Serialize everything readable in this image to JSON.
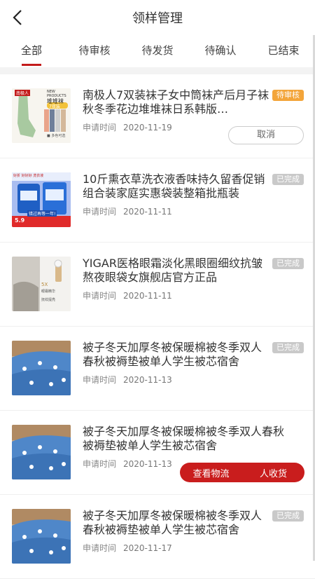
{
  "header": {
    "title": "领样管理"
  },
  "tabs": [
    {
      "label": "全部",
      "active": true
    },
    {
      "label": "待审核"
    },
    {
      "label": "待发货"
    },
    {
      "label": "待确认"
    },
    {
      "label": "已结束"
    }
  ],
  "date_label": "申请时间",
  "items": [
    {
      "name": "南极人7双装袜子女中筒袜产后月子袜秋冬季花边堆堆袜日系韩版…",
      "status": "待审核",
      "status_type": "pending",
      "date": "2020-11-19",
      "action": "取消",
      "thumb": {
        "badge": "南极人",
        "tag": "NEW PRODUCTS",
        "title": "堆堆袜",
        "count": "7双装",
        "note": "■ 多色可选"
      }
    },
    {
      "name": "10斤熏衣草洗衣液香味持久留香促销组合装家庭实惠袋装整箱批瓶装",
      "status": "已完成",
      "status_type": "done",
      "date": "2020-11-11",
      "thumb": {
        "top_left": "好折 好好好 洗衣液",
        "price": "5.9",
        "banner": "错过再等一年!"
      }
    },
    {
      "name": "YIGAR医格眼霜淡化黑眼圈细纹抗皱熬夜眼袋女旗舰店官方正品",
      "status": "已完成",
      "status_type": "done",
      "date": "2020-11-11",
      "thumb": {
        "line1": "5X",
        "line2": "眼霜精华",
        "line3": "抚纹提亮"
      }
    },
    {
      "name": "被子冬天加厚冬被保暖棉被冬季双人春秋被褥垫被单人学生被芯宿舍",
      "status": "已完成",
      "status_type": "done",
      "date": "2020-11-13"
    },
    {
      "name": "被子冬天加厚冬被保暖棉被冬季双人春秋被褥垫被单人学生被芯宿舍",
      "status": "已完成",
      "status_type": "done",
      "date": "2020-11-13"
    },
    {
      "name": "被子冬天加厚冬被保暖棉被冬季双人春秋被褥垫被单人学生被芯宿舍",
      "status": "已完成",
      "status_type": "done",
      "date": "2020-11-17"
    }
  ],
  "overlay_actions": {
    "logistics": "查看物流",
    "receive": "人收货"
  },
  "colors": {
    "accent": "#c91d1d",
    "pending": "#f3a53a",
    "done": "#c9c9c9"
  }
}
